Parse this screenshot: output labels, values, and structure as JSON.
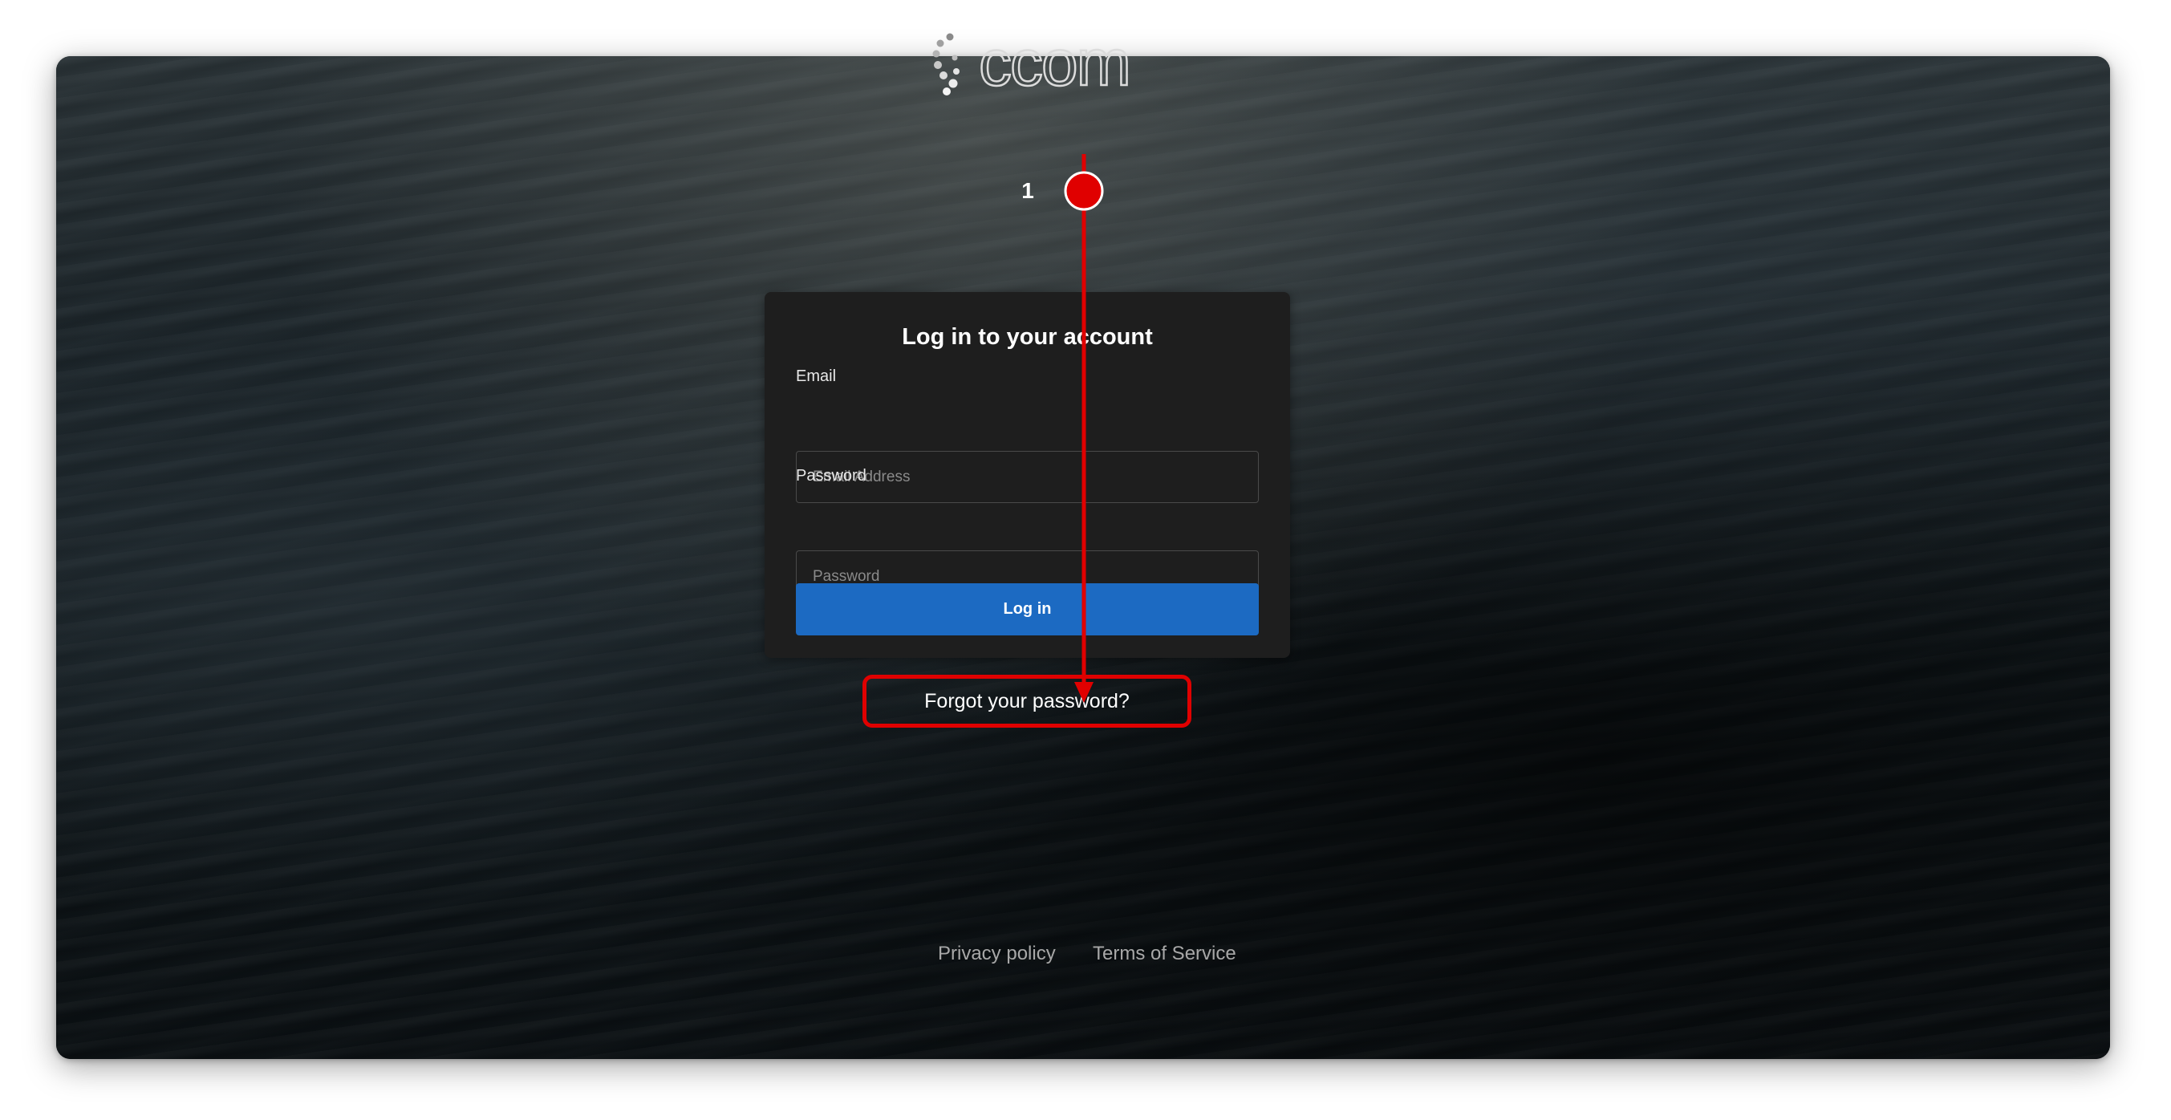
{
  "brand": {
    "logo_text": "ccom",
    "logo_icon": "dotted-spinner-icon"
  },
  "login_card": {
    "title": "Log in to your account",
    "email_label": "Email",
    "email_placeholder": "Email Address",
    "email_value": "",
    "password_label": "Password",
    "password_placeholder": "Password",
    "password_value": "",
    "login_button": "Log in"
  },
  "forgot_password": "Forgot your password?",
  "footer": {
    "privacy": "Privacy policy",
    "terms": "Terms of Service"
  },
  "annotation": {
    "step_number": "1",
    "color": "#e00000"
  },
  "colors": {
    "primary_button": "#1c6ac2",
    "card_background": "#1e1e1e"
  }
}
